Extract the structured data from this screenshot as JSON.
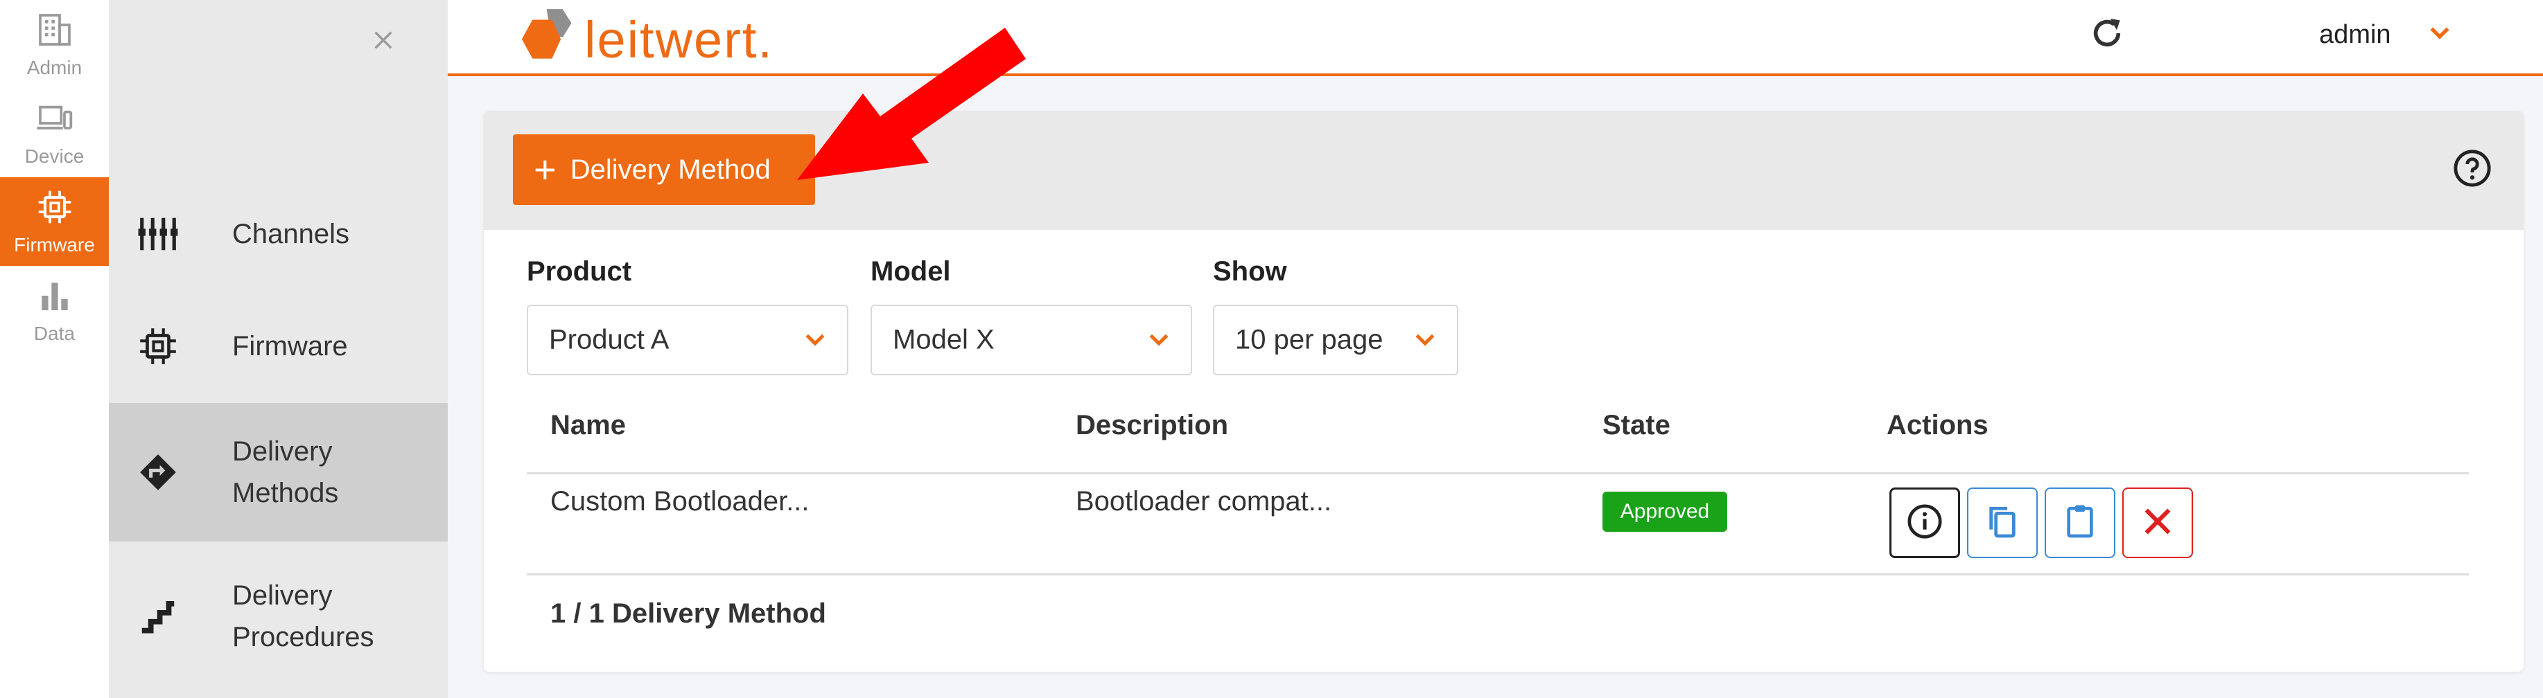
{
  "rail": {
    "items": [
      {
        "label": "Admin",
        "icon": "building-icon"
      },
      {
        "label": "Device",
        "icon": "devices-icon"
      },
      {
        "label": "Firmware",
        "icon": "chip-icon"
      },
      {
        "label": "Data",
        "icon": "bar-chart-icon"
      }
    ],
    "active_color": "#ee6a13"
  },
  "subnav": {
    "items": [
      {
        "label": "Channels",
        "icon": "sliders-icon"
      },
      {
        "label": "Firmware",
        "icon": "chip-icon"
      },
      {
        "label": "Delivery Methods",
        "icon": "route-diamond-icon"
      },
      {
        "label": "Delivery Procedures",
        "icon": "steps-icon"
      }
    ]
  },
  "header": {
    "logo_text": "leitwert.",
    "user": "admin"
  },
  "toolbar": {
    "add_label": "Delivery Method"
  },
  "filters": {
    "product": {
      "label": "Product",
      "value": "Product A"
    },
    "model": {
      "label": "Model",
      "value": "Model X"
    },
    "show": {
      "label": "Show",
      "value": "10 per page"
    }
  },
  "table": {
    "columns": [
      "Name",
      "Description",
      "State",
      "Actions"
    ],
    "rows": [
      {
        "name": "Custom Bootloader...",
        "description": "Bootloader compat...",
        "state": "Approved"
      }
    ],
    "footer": "1 / 1 Delivery Method"
  },
  "colors": {
    "brand": "#ee6a13",
    "approved": "#1aa319",
    "copy": "#3a8ad6",
    "delete": "#e02020"
  }
}
